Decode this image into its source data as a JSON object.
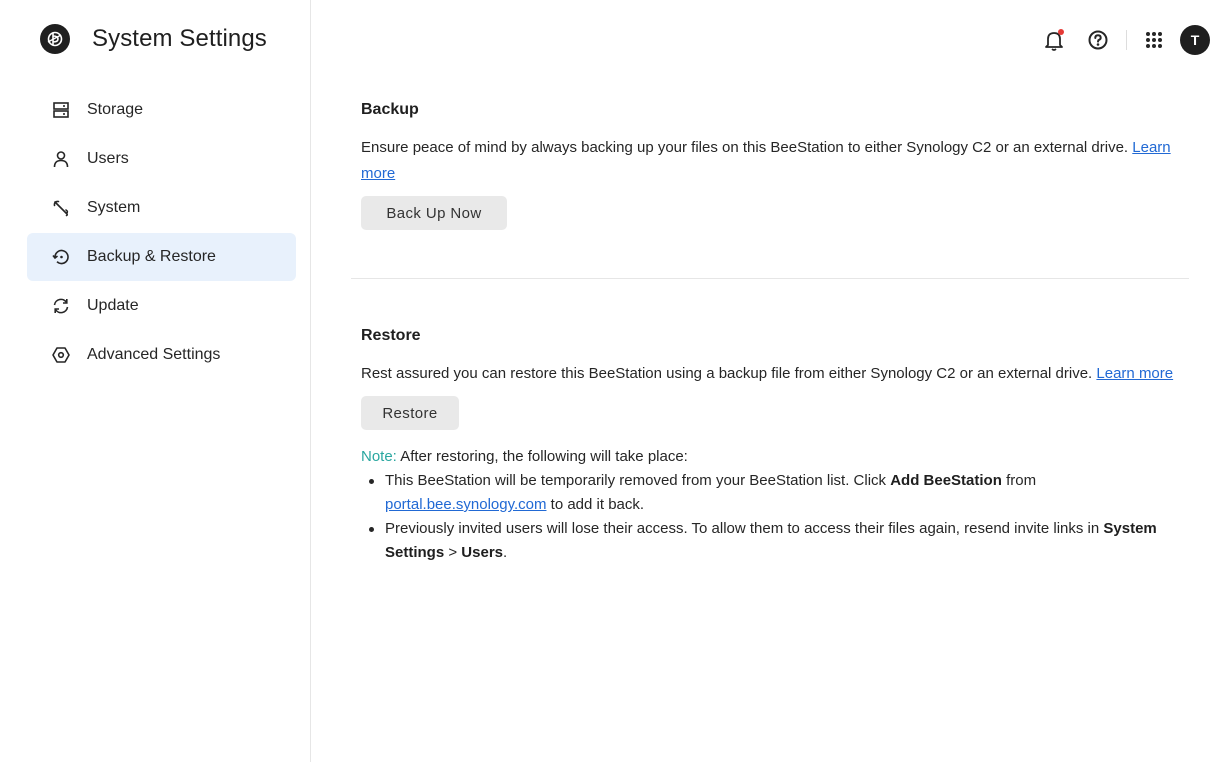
{
  "app": {
    "title": "System Settings"
  },
  "sidebar": {
    "items": [
      {
        "label": "Storage",
        "icon": "storage-icon"
      },
      {
        "label": "Users",
        "icon": "user-icon"
      },
      {
        "label": "System",
        "icon": "wrench-icon"
      },
      {
        "label": "Backup & Restore",
        "icon": "backup-restore-icon",
        "active": true
      },
      {
        "label": "Update",
        "icon": "update-icon"
      },
      {
        "label": "Advanced Settings",
        "icon": "advanced-settings-icon"
      }
    ]
  },
  "topbar": {
    "icons": [
      "notification-bell-icon",
      "help-icon",
      "apps-grid-icon"
    ],
    "notification_dot_color": "#e53935",
    "avatar_initial": "T"
  },
  "backup": {
    "title": "Backup",
    "description": "Ensure peace of mind by always backing up your files on this BeeStation to either Synology C2 or an external drive.",
    "learn_more": "Learn more",
    "button_label": "Back Up Now"
  },
  "restore": {
    "title": "Restore",
    "description": "Rest assured you can restore this BeeStation using a backup file from either Synology C2 or an external drive.",
    "learn_more": "Learn more",
    "button_label": "Restore",
    "note_label": "Note:",
    "note_text": "After restoring, the following will take place:",
    "bullet1": {
      "text_a": "This BeeStation will be temporarily removed from your BeeStation list. Click",
      "bold": "Add BeeStation",
      "text_b": "from",
      "link": "portal.bee.synology.com",
      "text_c": "to add it back."
    },
    "bullet2": {
      "text_a": "Previously invited users will lose their access. To allow them to access their files again, resend invite links in",
      "bold1": "System Settings",
      "sep": ">",
      "bold2": "Users",
      "end": "."
    }
  },
  "colors": {
    "accent": "#2169d4",
    "active_bg": "#e8f1fc",
    "note": "#2aa7a0"
  }
}
